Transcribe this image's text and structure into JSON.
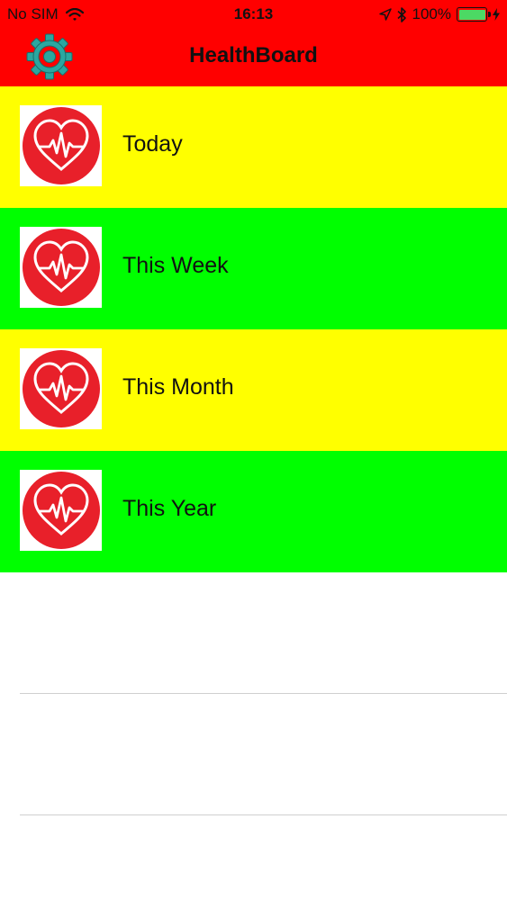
{
  "status_bar": {
    "carrier": "No SIM",
    "time": "16:13",
    "battery_percent": "100%",
    "battery_level": 1.0
  },
  "nav": {
    "title": "HealthBoard",
    "settings_icon": "gear-icon"
  },
  "colors": {
    "header": "#ff0000",
    "row_yellow": "#ffff00",
    "row_green": "#00ff00",
    "heart_badge": "#e8202a",
    "gear": "#2ba7a0",
    "battery": "#4cd964"
  },
  "rows": [
    {
      "label": "Today",
      "icon": "heart-pulse-icon",
      "color": "#ffff00"
    },
    {
      "label": "This Week",
      "icon": "heart-pulse-icon",
      "color": "#00ff00"
    },
    {
      "label": "This Month",
      "icon": "heart-pulse-icon",
      "color": "#ffff00"
    },
    {
      "label": "This Year",
      "icon": "heart-pulse-icon",
      "color": "#00ff00"
    }
  ]
}
